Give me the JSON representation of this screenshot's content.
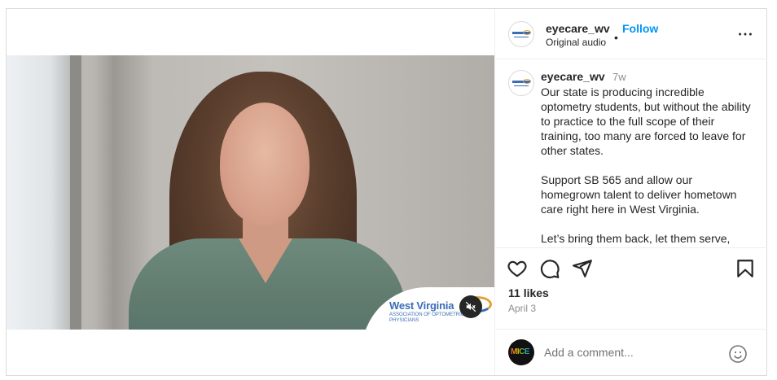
{
  "post": {
    "username": "eyecare_wv",
    "follow_label": "Follow",
    "dot": "•",
    "audio_label": "Original audio",
    "more_icon": "more-horizontal-icon"
  },
  "media": {
    "overlay_logo": {
      "title": "West Virginia",
      "subtitle": "Association of Optometric Physicians"
    },
    "mute_icon": "speaker-muted-icon"
  },
  "caption": {
    "username": "eyecare_wv",
    "time": "7w",
    "text": "Our state is producing incredible optometry students, but without the ability to practice to the full scope of their training, too many are forced to leave for other states.\n\nSupport SB 565 and allow our homegrown talent to deliver hometown care right here in West Virginia.\n\nLet’s bring them back, let them serve,"
  },
  "actions": {
    "like_icon": "heart-icon",
    "comment_icon": "comment-icon",
    "share_icon": "send-icon",
    "save_icon": "bookmark-icon",
    "likes": "11 likes",
    "date": "April 3"
  },
  "comment": {
    "placeholder": "Add a comment...",
    "avatar_text": "MICE",
    "emoji_icon": "smiley-icon"
  },
  "colors": {
    "follow": "#0095f6",
    "muted_text": "#8e8e8e",
    "border": "#dbdbdb"
  }
}
